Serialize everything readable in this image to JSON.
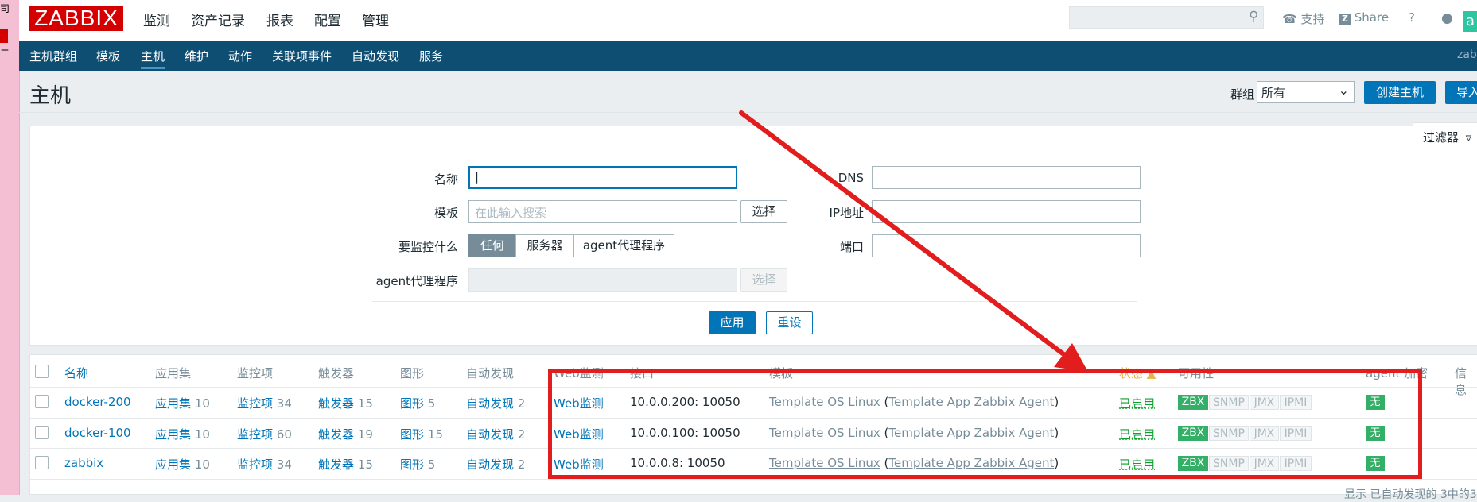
{
  "edge_strip": [
    "司",
    "二"
  ],
  "header": {
    "logo": "ZABBIX",
    "menu": [
      "监测",
      "资产记录",
      "报表",
      "配置",
      "管理"
    ],
    "support": "支持",
    "share": "Share",
    "help": "?",
    "avatar_text": "a"
  },
  "subnav": {
    "items": [
      "主机群组",
      "模板",
      "主机",
      "维护",
      "动作",
      "关联项事件",
      "自动发现",
      "服务"
    ],
    "right_text": "zab"
  },
  "page": {
    "title": "主机",
    "group_label": "群组",
    "group_value": "所有",
    "create_button": "创建主机",
    "import_button": "导入"
  },
  "filter": {
    "tab_label": "过滤器",
    "name_label": "名称",
    "template_label": "模板",
    "template_placeholder": "在此输入搜索",
    "select_label": "选择",
    "monitored_by_label": "要监控什么",
    "monitored_by_options": [
      "任何",
      "服务器",
      "agent代理程序"
    ],
    "proxy_label": "agent代理程序",
    "dns_label": "DNS",
    "ip_label": "IP地址",
    "port_label": "端口",
    "apply": "应用",
    "reset": "重设"
  },
  "table": {
    "headers": {
      "name": "名称",
      "applications": "应用集",
      "items": "监控项",
      "triggers": "触发器",
      "graphs": "图形",
      "discovery": "自动发现",
      "web": "Web监测",
      "interface": "接口",
      "templates": "模板",
      "status": "状态 ▲",
      "availability": "可用性",
      "encryption": "agent 加密",
      "info": "信息"
    },
    "rows": [
      {
        "name": "docker-200",
        "app_label": "应用集",
        "app_count": "10",
        "items_label": "监控项",
        "items_count": "34",
        "triggers_label": "触发器",
        "triggers_count": "15",
        "graphs_label": "图形",
        "graphs_count": "5",
        "disc_label": "自动发现",
        "disc_count": "2",
        "web": "Web监测",
        "interface": "10.0.0.200: 10050",
        "template": "Template OS Linux",
        "template_paren": "Template App Zabbix Agent",
        "status": "已启用",
        "encryption": "无"
      },
      {
        "name": "docker-100",
        "app_label": "应用集",
        "app_count": "10",
        "items_label": "监控项",
        "items_count": "60",
        "triggers_label": "触发器",
        "triggers_count": "19",
        "graphs_label": "图形",
        "graphs_count": "15",
        "disc_label": "自动发现",
        "disc_count": "2",
        "web": "Web监测",
        "interface": "10.0.0.100: 10050",
        "template": "Template OS Linux",
        "template_paren": "Template App Zabbix Agent",
        "status": "已启用",
        "encryption": "无"
      },
      {
        "name": "zabbix",
        "app_label": "应用集",
        "app_count": "10",
        "items_label": "监控项",
        "items_count": "34",
        "triggers_label": "触发器",
        "triggers_count": "15",
        "graphs_label": "图形",
        "graphs_count": "5",
        "disc_label": "自动发现",
        "disc_count": "2",
        "web": "Web监测",
        "interface": "10.0.0.8: 10050",
        "template": "Template OS Linux",
        "template_paren": "Template App Zabbix Agent",
        "status": "已启用",
        "encryption": "无"
      }
    ],
    "availability_badges": [
      "ZBX",
      "SNMP",
      "JMX",
      "IPMI"
    ],
    "footer": "显示 已自动发现的 3中的3"
  },
  "colors": {
    "brand": "#d40000",
    "nav": "#0e4e72",
    "link": "#0275b8",
    "enabled": "#0e9f2c",
    "badge_on": "#34af67",
    "annotation": "#e11d1d"
  }
}
